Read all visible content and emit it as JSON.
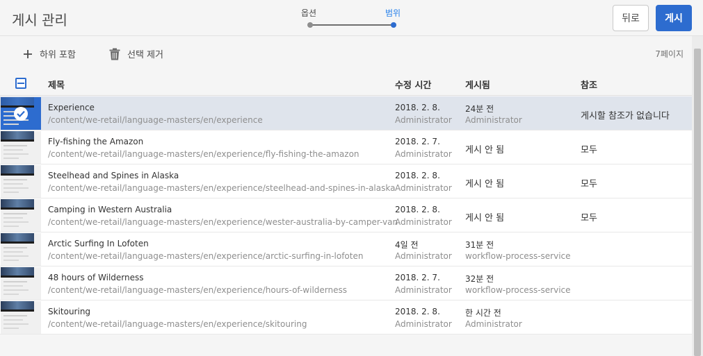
{
  "header": {
    "title": "게시 관리",
    "steps": [
      "옵션",
      "범위"
    ],
    "back_label": "뒤로",
    "publish_label": "게시"
  },
  "toolbar": {
    "add_children_label": "하위 포함",
    "remove_label": "선택 제거",
    "page_count": "7페이지"
  },
  "table": {
    "columns": [
      "제목",
      "수정 시간",
      "게시됨",
      "참조"
    ],
    "rows": [
      {
        "title": "Experience",
        "path": "/content/we-retail/language-masters/en/experience",
        "modified": "2018. 2. 8.",
        "modified_by": "Administrator",
        "published": "24분 전",
        "published_by": "Administrator",
        "published_single": "",
        "references": "게시할 참조가 없습니다"
      },
      {
        "title": "Fly-fishing the Amazon",
        "path": "/content/we-retail/language-masters/en/experience/fly-fishing-the-amazon",
        "modified": "2018. 2. 7.",
        "modified_by": "Administrator",
        "published": "",
        "published_by": "",
        "published_single": "게시 안 됨",
        "references": "모두"
      },
      {
        "title": "Steelhead and Spines in Alaska",
        "path": "/content/we-retail/language-masters/en/experience/steelhead-and-spines-in-alaska",
        "modified": "2018. 2. 8.",
        "modified_by": "Administrator",
        "published": "",
        "published_by": "",
        "published_single": "게시 안 됨",
        "references": "모두"
      },
      {
        "title": "Camping in Western Australia",
        "path": "/content/we-retail/language-masters/en/experience/wester-australia-by-camper-van",
        "modified": "2018. 2. 8.",
        "modified_by": "Administrator",
        "published": "",
        "published_by": "",
        "published_single": "게시 안 됨",
        "references": "모두"
      },
      {
        "title": "Arctic Surfing In Lofoten",
        "path": "/content/we-retail/language-masters/en/experience/arctic-surfing-in-lofoten",
        "modified": "4일 전",
        "modified_by": "Administrator",
        "published": "31분 전",
        "published_by": "workflow-process-service",
        "published_single": "",
        "references": ""
      },
      {
        "title": "48 hours of Wilderness",
        "path": "/content/we-retail/language-masters/en/experience/hours-of-wilderness",
        "modified": "2018. 2. 7.",
        "modified_by": "Administrator",
        "published": "32분 전",
        "published_by": "workflow-process-service",
        "published_single": "",
        "references": ""
      },
      {
        "title": "Skitouring",
        "path": "/content/we-retail/language-masters/en/experience/skitouring",
        "modified": "2018. 2. 8.",
        "modified_by": "Administrator",
        "published": "한 시간 전",
        "published_by": "Administrator",
        "published_single": "",
        "references": ""
      }
    ]
  },
  "colors": {
    "accent": "#2d6ccf",
    "selected_row": "#dfe4ec"
  }
}
